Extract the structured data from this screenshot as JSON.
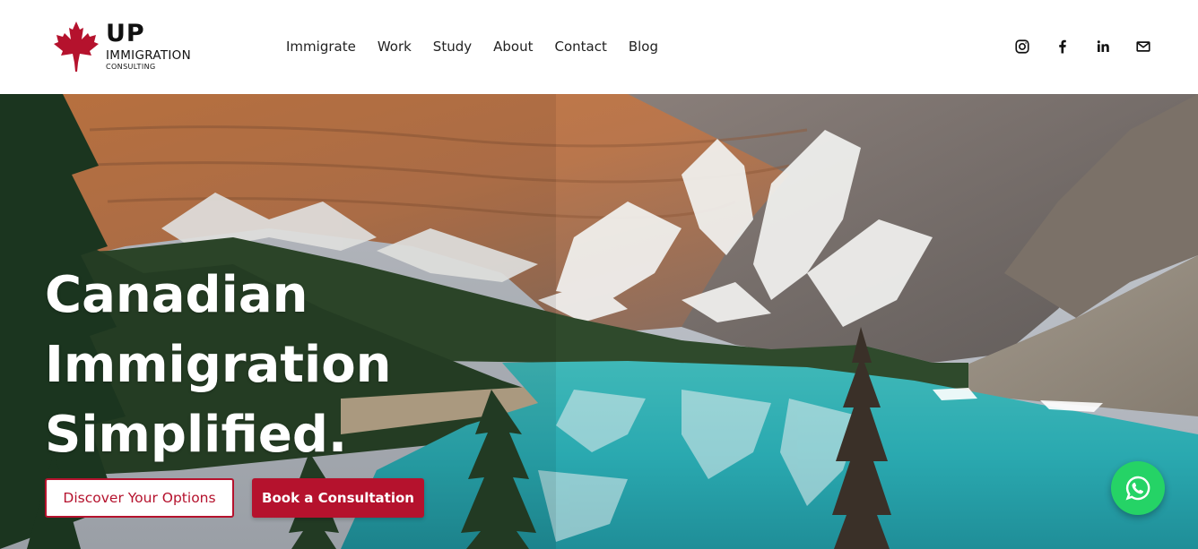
{
  "brand": {
    "line1": "UP",
    "line2": "IMMIGRATION",
    "line3": "CONSULTING",
    "accent_color": "#b5122d"
  },
  "nav": {
    "items": [
      {
        "label": "Immigrate"
      },
      {
        "label": "Work"
      },
      {
        "label": "Study"
      },
      {
        "label": "About"
      },
      {
        "label": "Contact"
      },
      {
        "label": "Blog"
      }
    ]
  },
  "social": {
    "icons": [
      "instagram-icon",
      "facebook-icon",
      "linkedin-icon",
      "email-icon"
    ]
  },
  "hero": {
    "headline": [
      "Canadian",
      "Immigration",
      "Simplified."
    ],
    "primary_button": "Discover Your Options",
    "secondary_button": "Book a Consultation",
    "chat_icon": "whatsapp-icon",
    "chat_color": "#25d366"
  }
}
